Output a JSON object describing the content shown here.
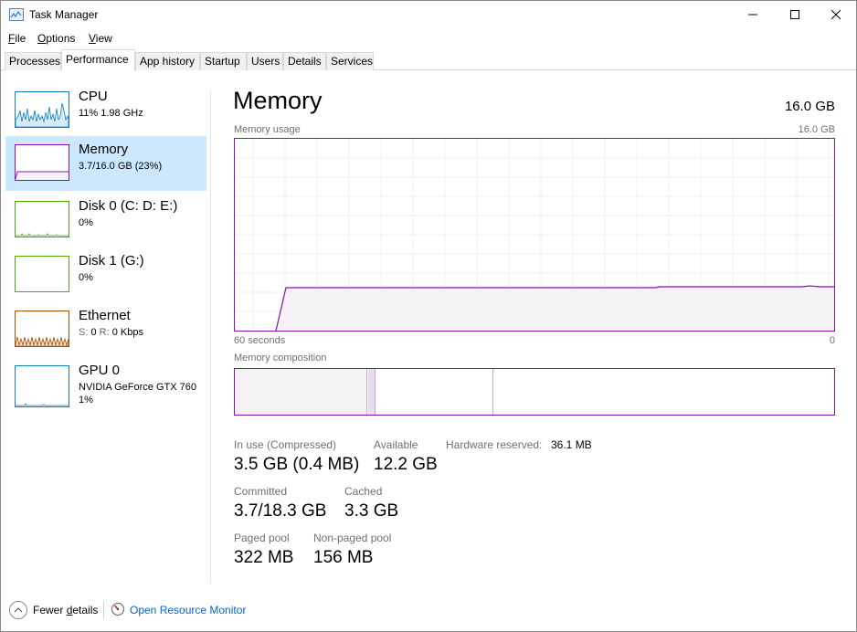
{
  "window": {
    "title": "Task Manager",
    "icon": "task-manager-icon"
  },
  "menu": [
    {
      "label": "File",
      "underline": "F"
    },
    {
      "label": "Options",
      "underline": "O"
    },
    {
      "label": "View",
      "underline": "V"
    }
  ],
  "tabs": [
    {
      "label": "Processes",
      "active": false
    },
    {
      "label": "Performance",
      "active": true
    },
    {
      "label": "App history",
      "active": false
    },
    {
      "label": "Startup",
      "active": false
    },
    {
      "label": "Users",
      "active": false
    },
    {
      "label": "Details",
      "active": false
    },
    {
      "label": "Services",
      "active": false
    }
  ],
  "sidebar": {
    "items": [
      {
        "title": "CPU",
        "sub": "11%  1.98 GHz",
        "color": "#117dbb",
        "selected": false
      },
      {
        "title": "Memory",
        "sub": "3.7/16.0 GB (23%)",
        "color": "#8b12ae",
        "selected": true
      },
      {
        "title": "Disk 0 (C: D: E:)",
        "sub": "0%",
        "color": "#4da60c",
        "selected": false
      },
      {
        "title": "Disk 1 (G:)",
        "sub": "0%",
        "color": "#4da60c",
        "selected": false
      },
      {
        "title": "Ethernet",
        "sub_s": "S:",
        "sub_s_val": "0",
        "sub_r": "R:",
        "sub_r_val": "0 Kbps",
        "color": "#a74f01",
        "selected": false
      },
      {
        "title": "GPU 0",
        "sub": "NVIDIA GeForce GTX 760",
        "sub2": "1%",
        "color": "#117dbb",
        "selected": false
      }
    ]
  },
  "main": {
    "title": "Memory",
    "total": "16.0 GB",
    "usage_label": "Memory usage",
    "usage_max": "16.0 GB",
    "x_left": "60 seconds",
    "x_right": "0",
    "usage_fraction": 0.23,
    "composition_label": "Memory composition",
    "composition": {
      "in_use_fraction": 0.22,
      "modified_fraction": 0.01,
      "standby_fraction": 0.195
    },
    "color": "#8b12ae"
  },
  "stats": {
    "in_use_label": "In use (Compressed)",
    "in_use_value": "3.5 GB (0.4 MB)",
    "available_label": "Available",
    "available_value": "12.2 GB",
    "hw_reserved_label": "Hardware reserved:",
    "hw_reserved_value": "36.1 MB",
    "committed_label": "Committed",
    "committed_value": "3.7/18.3 GB",
    "cached_label": "Cached",
    "cached_value": "3.3 GB",
    "paged_label": "Paged pool",
    "paged_value": "322 MB",
    "nonpaged_label": "Non-paged pool",
    "nonpaged_value": "156 MB"
  },
  "footer": {
    "fewer_details": "Fewer details",
    "fewer_underline": "d",
    "resource_monitor": "Open Resource Monitor"
  }
}
